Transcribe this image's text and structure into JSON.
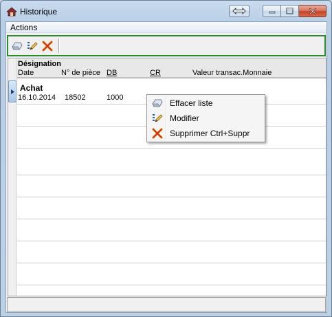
{
  "window": {
    "title": "Historique"
  },
  "menubar": {
    "actions": "Actions"
  },
  "toolbar": {
    "tools": [
      {
        "icon": "eraser-icon"
      },
      {
        "icon": "edit-icon"
      },
      {
        "icon": "delete-icon"
      }
    ]
  },
  "grid": {
    "header": {
      "designation": "Désignation",
      "columns": [
        "Date",
        "N° de pièce",
        "DB",
        "CR",
        "Valeur transac.Monnaie"
      ]
    },
    "rows": [
      {
        "designation": "Achat",
        "date": "16.10.2014",
        "piece": "18502",
        "db": "1000",
        "cr": "",
        "valeur": ""
      }
    ]
  },
  "context_menu": {
    "items": [
      {
        "label": "Effacer liste",
        "icon": "eraser-icon"
      },
      {
        "label": "Modifier",
        "icon": "edit-icon"
      },
      {
        "label": "Supprimer Ctrl+Suppr",
        "icon": "delete-icon"
      }
    ]
  },
  "colors": {
    "toolbar_border": "#2f8a2f",
    "close_button": "#c7432a",
    "titlebar": "#c9dcef"
  }
}
